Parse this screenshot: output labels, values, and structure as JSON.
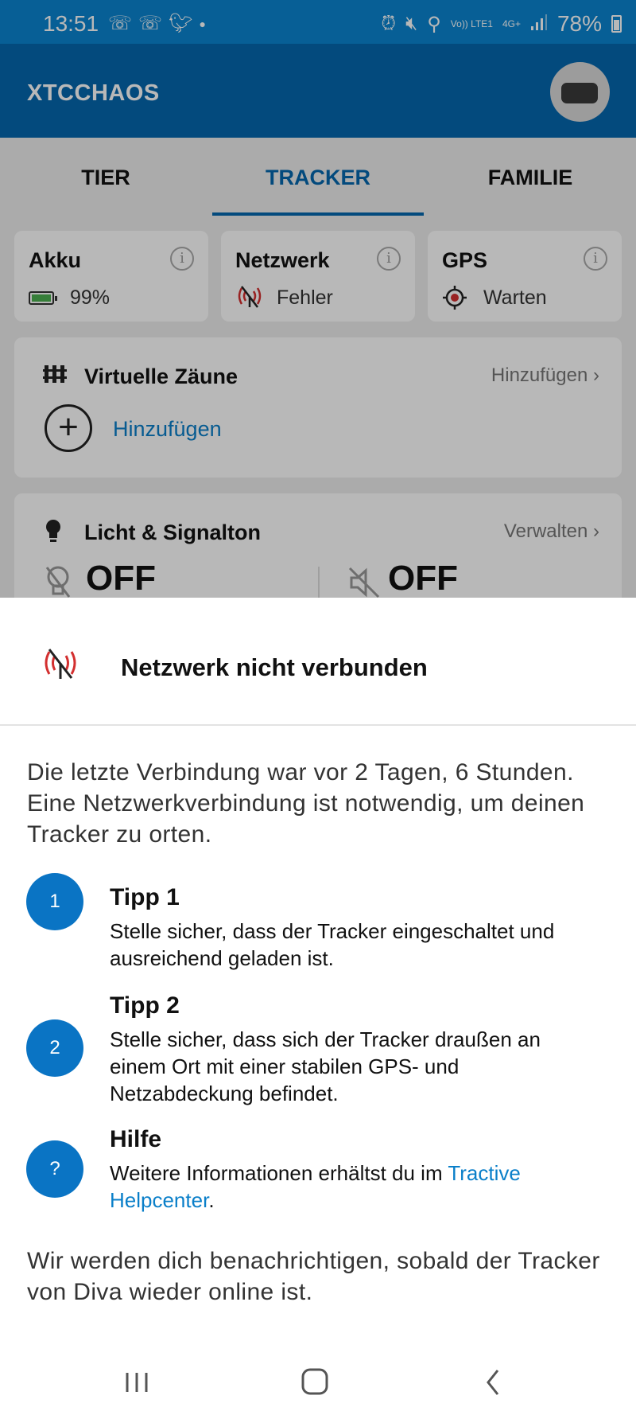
{
  "status_bar": {
    "time": "13:51",
    "left_icons": [
      "notification-icon",
      "notification-icon",
      "twitter-icon",
      "dot-icon"
    ],
    "right_icons": [
      "alarm-icon",
      "mute-icon",
      "location-icon",
      "volte-icon",
      "4g-icon",
      "signal-icon"
    ],
    "volte_label": "Vo)) LTE1",
    "network_label": "4G+",
    "battery": "78%"
  },
  "app_bar": {
    "title": "XTCCHAOS",
    "avatar_icon": "tracker-device-icon"
  },
  "tabs": [
    {
      "label": "TIER",
      "active": false
    },
    {
      "label": "TRACKER",
      "active": true
    },
    {
      "label": "FAMILIE",
      "active": false
    }
  ],
  "stats": [
    {
      "title": "Akku",
      "value": "99%",
      "icon": "battery-icon",
      "info_icon": "info-icon"
    },
    {
      "title": "Netzwerk",
      "value": "Fehler",
      "icon": "no-signal-icon",
      "info_icon": "info-icon"
    },
    {
      "title": "GPS",
      "value": "Warten",
      "icon": "gps-target-icon",
      "info_icon": "info-icon"
    }
  ],
  "fences": {
    "icon": "fence-icon",
    "title": "Virtuelle Zäune",
    "link": "Hinzufügen",
    "add_label": "Hinzufügen"
  },
  "light": {
    "icon": "bulb-icon",
    "title": "Licht & Signalton",
    "link": "Verwalten",
    "light_state": "OFF",
    "sound_state": "OFF"
  },
  "sheet": {
    "icon": "no-signal-icon",
    "title": "Netzwerk nicht verbunden",
    "description": "Die letzte Verbindung war vor 2 Tagen, 6 Stunden. Eine Netzwerkverbindung ist notwendig, um deinen Tracker zu orten.",
    "tips": [
      {
        "badge": "1",
        "title": "Tipp 1",
        "text": "Stelle sicher, dass der Tracker eingeschaltet und ausreichend geladen ist."
      },
      {
        "badge": "2",
        "title": "Tipp 2",
        "text": "Stelle sicher, dass sich der Tracker draußen an einem Ort mit einer stabilen GPS- und Netzabdeckung befindet."
      }
    ],
    "help": {
      "badge": "?",
      "title": "Hilfe",
      "text": "Weitere Informationen erhältst du im ",
      "link": "Tractive Helpcenter",
      "suffix": "."
    },
    "footer": "Wir werden dich benachrichtigen, sobald der Tracker von Diva wieder online ist."
  },
  "nav_bar": {
    "items": [
      "recents-icon",
      "home-icon",
      "back-icon"
    ]
  },
  "colors": {
    "primary": "#0567ad",
    "status": "#0a84d0",
    "link": "#0a7fc9",
    "error": "#d32f2f",
    "badge": "#0a74c4"
  }
}
